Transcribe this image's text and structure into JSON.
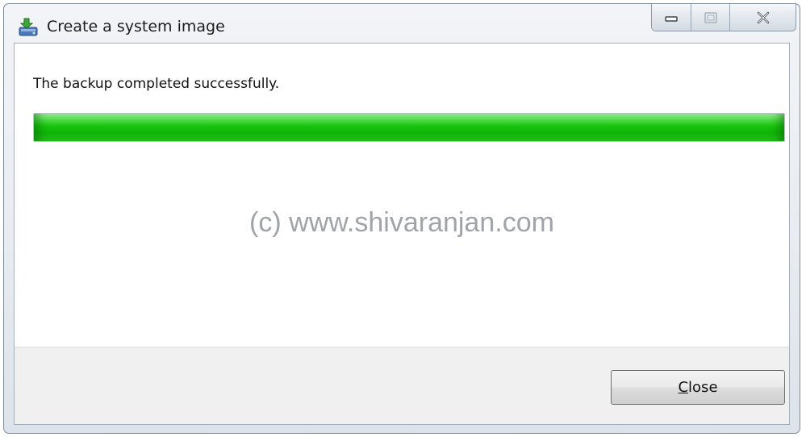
{
  "window": {
    "title": "Create a system image",
    "app_icon": "backup-icon",
    "caption_buttons": {
      "minimize_icon": "minimize-icon",
      "maximize_icon": "maximize-icon",
      "close_icon": "close-icon"
    }
  },
  "content": {
    "status_message": "The backup completed successfully.",
    "progress": {
      "value_percent": 100,
      "color": "#18c40f"
    },
    "watermark": "(c) www.shivaranjan.com"
  },
  "footer": {
    "close_button": {
      "mnemonic": "C",
      "rest": "lose"
    }
  }
}
